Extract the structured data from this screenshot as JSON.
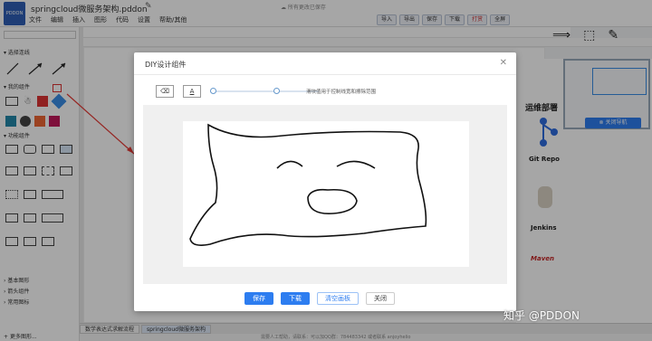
{
  "app": {
    "doc_title": "springcloud微服务架构.pddon",
    "saved_status": "所有更改已保存",
    "logo_text": "PDDON"
  },
  "menu": [
    "文件",
    "编辑",
    "插入",
    "图形",
    "代码",
    "设置",
    "帮助/其他"
  ],
  "top_buttons": [
    {
      "label": "导入",
      "style": "normal"
    },
    {
      "label": "导出",
      "style": "normal"
    },
    {
      "label": "保存",
      "style": "normal"
    },
    {
      "label": "下载",
      "style": "normal"
    },
    {
      "label": "打赏",
      "style": "red"
    },
    {
      "label": "全屏",
      "style": "normal"
    }
  ],
  "sidebar": {
    "sections": [
      {
        "label": "选择连线"
      },
      {
        "label": "我的组件"
      },
      {
        "label": "功能组件"
      }
    ],
    "collapsed_sections": [
      "基本图形",
      "箭头组件",
      "常用图标"
    ],
    "more_shapes": "更多图形..."
  },
  "right_panel": {
    "close_map_label": "关闭导航",
    "ops_title": "运维部署",
    "nodes": [
      "Git Repo",
      "Jenkins",
      "Maven"
    ]
  },
  "modal": {
    "title": "DIY设计组件",
    "hint": "滑块值用于控制线宽和擦除范围",
    "pen_slider_value": 0.0,
    "eraser_slider_value": 0.0,
    "buttons": {
      "save": "保存",
      "download": "下载",
      "clear": "清空画板",
      "close": "关闭"
    }
  },
  "bottom_tabs": [
    {
      "label": "数学表达式求解流程",
      "active": false
    },
    {
      "label": "springcloud微服务架构",
      "active": true
    }
  ],
  "statusbar": "需要人工帮助，请联系：可以加QQ群：784483342 或者联系 anjoyhelio",
  "watermark": "知乎 @PDDON",
  "colors": {
    "accent": "#2d7df0",
    "logo": "#2f5fb5"
  }
}
